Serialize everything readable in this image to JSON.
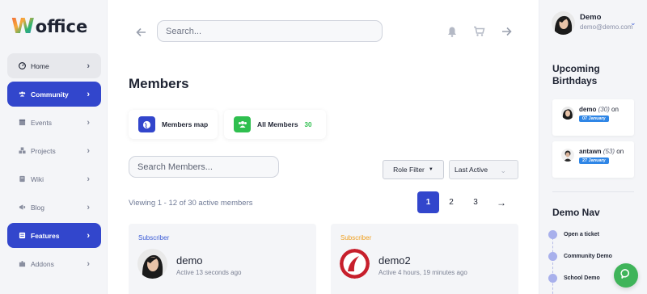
{
  "brand": {
    "logo_first": "W",
    "logo_rest": "office"
  },
  "sidebar": {
    "items": [
      {
        "label": "Home",
        "icon": "gauge-icon",
        "state": "home"
      },
      {
        "label": "Community",
        "icon": "users-icon",
        "state": "active"
      },
      {
        "label": "Events",
        "icon": "calendar-icon",
        "state": "normal"
      },
      {
        "label": "Projects",
        "icon": "cubes-icon",
        "state": "normal"
      },
      {
        "label": "Wiki",
        "icon": "book-icon",
        "state": "normal"
      },
      {
        "label": "Blog",
        "icon": "megaphone-icon",
        "state": "normal"
      },
      {
        "label": "Features",
        "icon": "list-icon",
        "state": "active"
      },
      {
        "label": "Addons",
        "icon": "puzzle-icon",
        "state": "normal"
      }
    ]
  },
  "topbar": {
    "search_placeholder": "Search..."
  },
  "main": {
    "title": "Members",
    "quick_links": [
      {
        "label": "Members map",
        "icon": "globe-icon",
        "color": "#3246cc"
      },
      {
        "label": "All Members",
        "icon": "users-icon",
        "color": "#2fbf4f",
        "count": "30"
      }
    ],
    "search_placeholder": "Search Members...",
    "role_filter_label": "Role Filter",
    "sort_value": "Last Active",
    "viewing_text": "Viewing 1 - 12 of 30 active members",
    "pagination": {
      "current": "1",
      "pages": [
        "2",
        "3"
      ],
      "next": "→"
    },
    "members": [
      {
        "role": "Subscriber",
        "role_color": "#3a5bd6",
        "name": "demo",
        "active": "Active 13 seconds ago"
      },
      {
        "role": "Subscriber",
        "role_color": "#f0a020",
        "name": "demo2",
        "active": "Active 4 hours, 19 minutes ago"
      }
    ]
  },
  "right_sidebar": {
    "user": {
      "name": "Demo",
      "email": "demo@demo.com"
    },
    "birthdays_title": "Upcoming Birthdays",
    "birthdays": [
      {
        "name": "demo",
        "age": "(30)",
        "suffix": "on",
        "date": "07 January"
      },
      {
        "name": "antawn",
        "age": "(53)",
        "suffix": "on",
        "date": "27 January"
      }
    ],
    "demo_nav_title": "Demo Nav",
    "demo_nav": [
      "Open a ticket",
      "Community Demo",
      "School Demo"
    ]
  }
}
